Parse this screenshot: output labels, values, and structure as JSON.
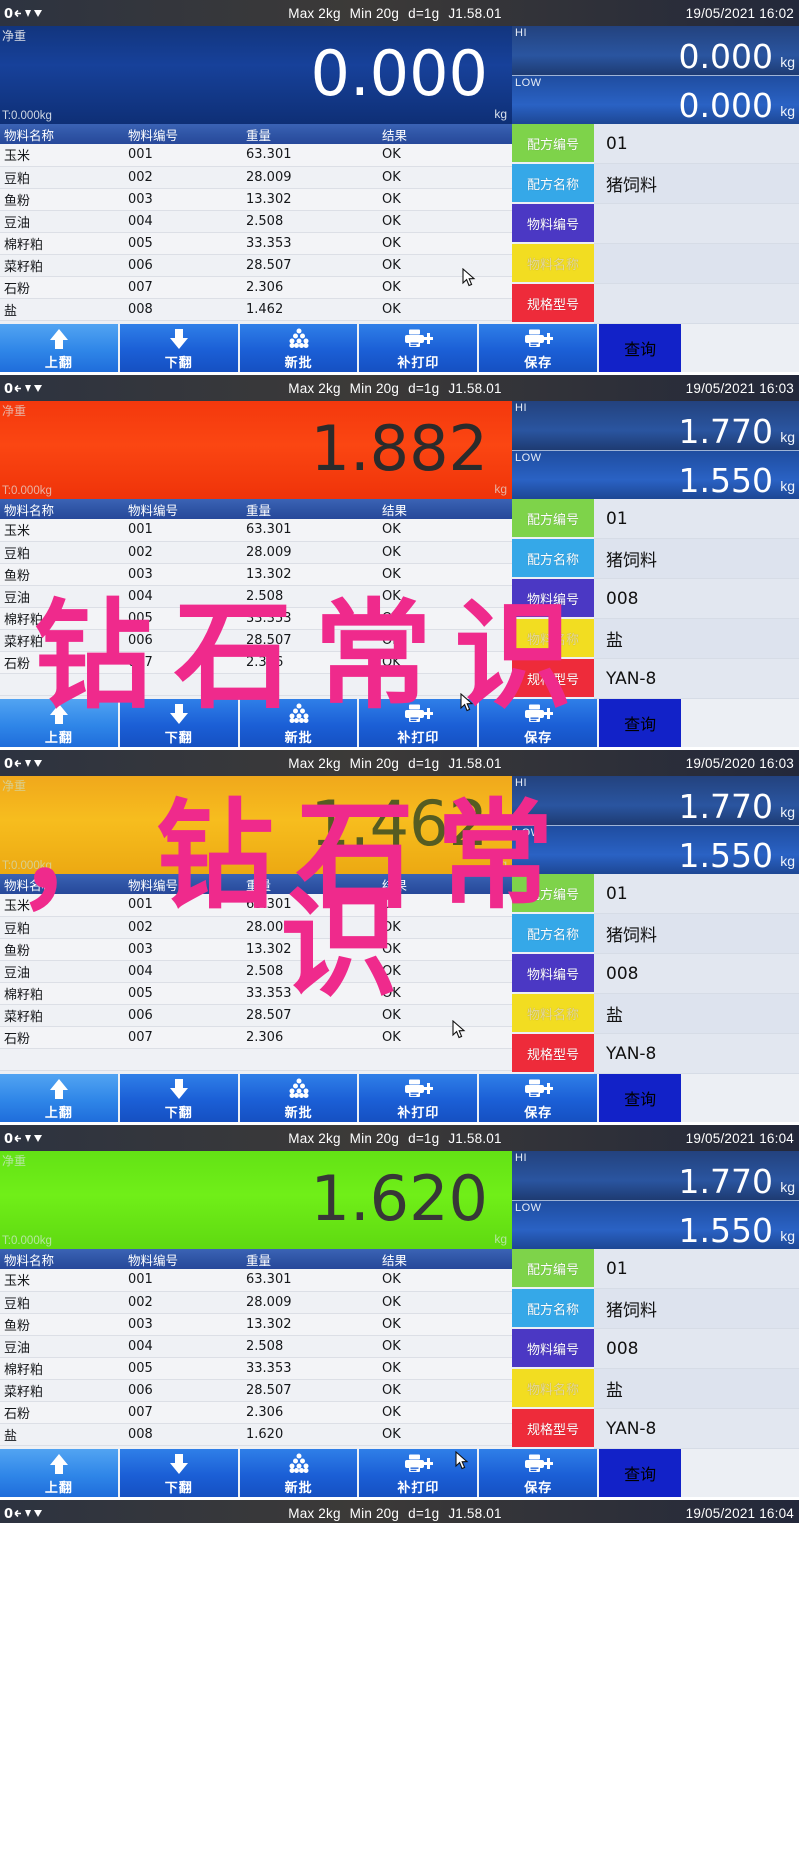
{
  "device": {
    "statusbar": {
      "icons": [
        "zero-icon",
        "tare-icon",
        "stable-icon"
      ],
      "spec_max": "Max 2kg",
      "spec_min": "Min 20g",
      "spec_d": "d=1g",
      "firmware": "J1.58.01"
    },
    "labels": {
      "net": "净重",
      "tare": "T:0.000kg",
      "unit": "kg",
      "hi": "HI",
      "low": "LOW"
    },
    "table_headers": [
      "物料名称",
      "物料编号",
      "重量",
      "结果"
    ],
    "keys": [
      {
        "name": "配方编号",
        "color": "#7ed34a"
      },
      {
        "name": "配方名称",
        "color": "#35a8e8"
      },
      {
        "name": "物料编号",
        "color": "#4b38c4"
      },
      {
        "name": "物料名称",
        "color": "#f2dd21"
      },
      {
        "name": "规格型号",
        "color": "#ee2b3a"
      },
      {
        "name": "查询",
        "color": "#1222c8"
      }
    ],
    "toolbar": [
      {
        "label": "上翻",
        "icon": "arrow-up-icon"
      },
      {
        "label": "下翻",
        "icon": "arrow-down-icon"
      },
      {
        "label": "新批",
        "icon": "batch-stack-icon"
      },
      {
        "label": "补打印",
        "icon": "printer-plus-icon"
      },
      {
        "label": "保存",
        "icon": "printer-plus-icon"
      }
    ],
    "query_label": "查询"
  },
  "watermark": {
    "line1": "钻石常识",
    "line2": "，钻石常",
    "line3": "识"
  },
  "panels": [
    {
      "id": "panel-1",
      "mode": "zero",
      "date": "19/05/2021",
      "time": "16:02",
      "weight": "0.000",
      "hi": "0.000",
      "low": "0.000",
      "rows": [
        {
          "name": "玉米",
          "code": "001",
          "weight": "63.301",
          "result": "OK"
        },
        {
          "name": "豆粕",
          "code": "002",
          "weight": "28.009",
          "result": "OK"
        },
        {
          "name": "鱼粉",
          "code": "003",
          "weight": "13.302",
          "result": "OK"
        },
        {
          "name": "豆油",
          "code": "004",
          "weight": "2.508",
          "result": "OK"
        },
        {
          "name": "棉籽粕",
          "code": "005",
          "weight": "33.353",
          "result": "OK"
        },
        {
          "name": "菜籽粕",
          "code": "006",
          "weight": "28.507",
          "result": "OK"
        },
        {
          "name": "石粉",
          "code": "007",
          "weight": "2.306",
          "result": "OK"
        },
        {
          "name": "盐",
          "code": "008",
          "weight": "1.462",
          "result": "OK"
        }
      ],
      "side_values": [
        "01",
        "猪饲料",
        "",
        "",
        ""
      ]
    },
    {
      "id": "panel-2",
      "mode": "over",
      "date": "19/05/2021",
      "time": "16:03",
      "weight": "1.882",
      "hi": "1.770",
      "low": "1.550",
      "rows": [
        {
          "name": "玉米",
          "code": "001",
          "weight": "63.301",
          "result": "OK"
        },
        {
          "name": "豆粕",
          "code": "002",
          "weight": "28.009",
          "result": "OK"
        },
        {
          "name": "鱼粉",
          "code": "003",
          "weight": "13.302",
          "result": "OK"
        },
        {
          "name": "豆油",
          "code": "004",
          "weight": "2.508",
          "result": "OK"
        },
        {
          "name": "棉籽粕",
          "code": "005",
          "weight": "33.353",
          "result": "OK"
        },
        {
          "name": "菜籽粕",
          "code": "006",
          "weight": "28.507",
          "result": "OK"
        },
        {
          "name": "石粉",
          "code": "007",
          "weight": "2.306",
          "result": "OK"
        }
      ],
      "side_values": [
        "01",
        "猪饲料",
        "008",
        "盐",
        "YAN-8"
      ]
    },
    {
      "id": "panel-3",
      "mode": "under",
      "date": "19/05/2020",
      "time": "16:03",
      "weight": "1.462",
      "hi": "1.770",
      "low": "1.550",
      "rows": [
        {
          "name": "玉米",
          "code": "001",
          "weight": "63.301",
          "result": "OK"
        },
        {
          "name": "豆粕",
          "code": "002",
          "weight": "28.009",
          "result": "OK"
        },
        {
          "name": "鱼粉",
          "code": "003",
          "weight": "13.302",
          "result": "OK"
        },
        {
          "name": "豆油",
          "code": "004",
          "weight": "2.508",
          "result": "OK"
        },
        {
          "name": "棉籽粕",
          "code": "005",
          "weight": "33.353",
          "result": "OK"
        },
        {
          "name": "菜籽粕",
          "code": "006",
          "weight": "28.507",
          "result": "OK"
        },
        {
          "name": "石粉",
          "code": "007",
          "weight": "2.306",
          "result": "OK"
        }
      ],
      "side_values": [
        "01",
        "猪饲料",
        "008",
        "盐",
        "YAN-8"
      ]
    },
    {
      "id": "panel-4",
      "mode": "ok",
      "date": "19/05/2021",
      "time": "16:04",
      "weight": "1.620",
      "hi": "1.770",
      "low": "1.550",
      "rows": [
        {
          "name": "玉米",
          "code": "001",
          "weight": "63.301",
          "result": "OK"
        },
        {
          "name": "豆粕",
          "code": "002",
          "weight": "28.009",
          "result": "OK"
        },
        {
          "name": "鱼粉",
          "code": "003",
          "weight": "13.302",
          "result": "OK"
        },
        {
          "name": "豆油",
          "code": "004",
          "weight": "2.508",
          "result": "OK"
        },
        {
          "name": "棉籽粕",
          "code": "005",
          "weight": "33.353",
          "result": "OK"
        },
        {
          "name": "菜籽粕",
          "code": "006",
          "weight": "28.507",
          "result": "OK"
        },
        {
          "name": "石粉",
          "code": "007",
          "weight": "2.306",
          "result": "OK"
        },
        {
          "name": "盐",
          "code": "008",
          "weight": "1.620",
          "result": "OK"
        }
      ],
      "side_values": [
        "01",
        "猪饲料",
        "008",
        "盐",
        "YAN-8"
      ]
    },
    {
      "id": "panel-5",
      "mode": "zero",
      "partial": true,
      "date": "19/05/2021",
      "time": "16:04",
      "weight": "",
      "hi": "",
      "low": "",
      "rows": [],
      "side_values": []
    }
  ]
}
